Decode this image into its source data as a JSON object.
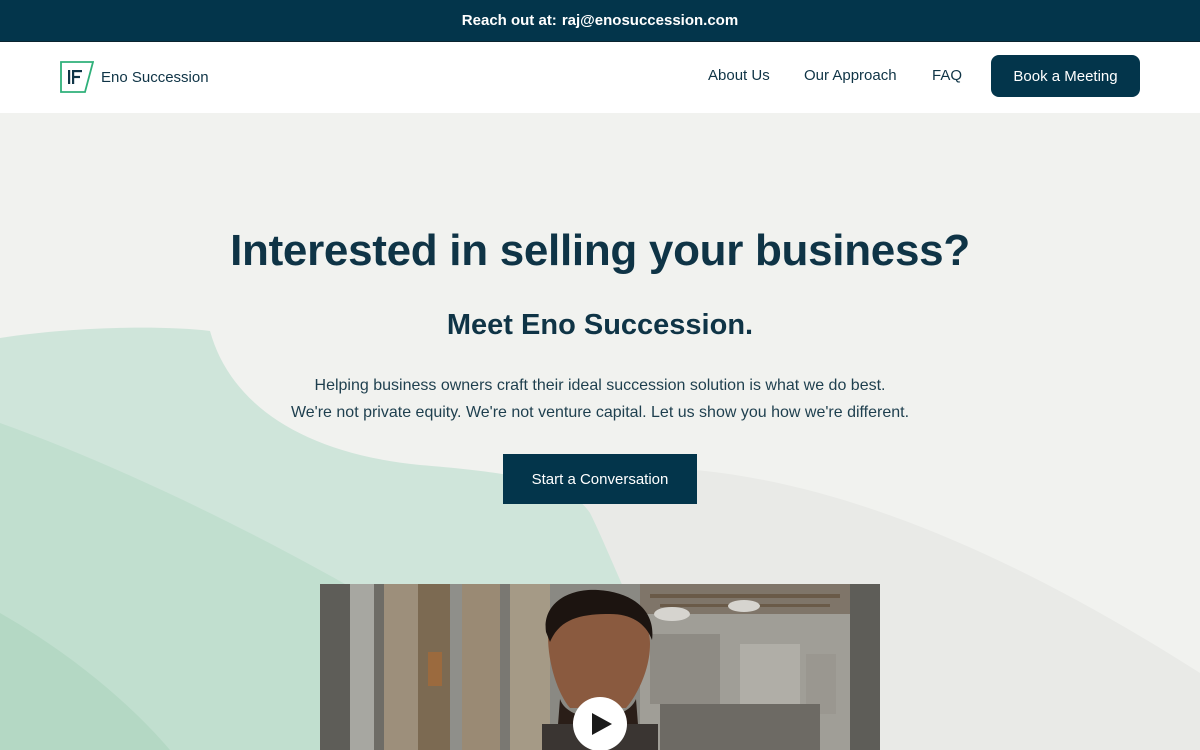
{
  "topbar": {
    "label": "Reach out at:",
    "email": "raj@enosuccession.com"
  },
  "brand": {
    "name": "Eno Succession",
    "logo_icon": "eno-logo-mark",
    "accent_color": "#2fb07a",
    "primary_color": "#03354b"
  },
  "nav": {
    "items": [
      {
        "label": "About Us"
      },
      {
        "label": "Our Approach"
      },
      {
        "label": "FAQ"
      }
    ],
    "cta_label": "Book a Meeting"
  },
  "hero": {
    "title": "Interested in selling your business?",
    "subtitle": "Meet Eno Succession.",
    "description_lines": [
      "Helping business owners craft their ideal succession solution is what we do best.",
      "We're not private equity. We're not venture capital. Let us show you how we're different."
    ],
    "cta_label": "Start a Conversation"
  },
  "video": {
    "play_icon": "play-icon"
  }
}
